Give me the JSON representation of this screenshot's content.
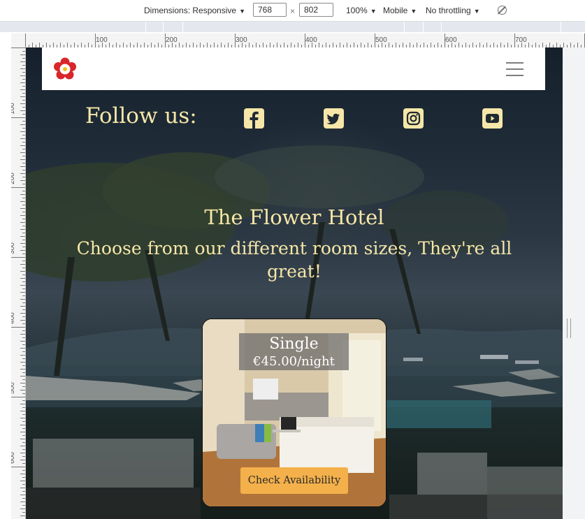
{
  "devtools": {
    "dimensions_label": "Dimensions: Responsive",
    "width_value": "768",
    "times_sign": "×",
    "height_value": "802",
    "zoom": "100%",
    "device_mode": "Mobile",
    "throttling": "No throttling",
    "ruler_top_labels": [
      "100",
      "200",
      "300",
      "400",
      "500",
      "600",
      "700"
    ],
    "ruler_left_labels": [
      "100",
      "200",
      "300",
      "400",
      "500",
      "600"
    ]
  },
  "navbar": {
    "logo_icon": "tudor-rose-icon",
    "menu_icon": "hamburger-menu-icon"
  },
  "social": {
    "label": "Follow us:",
    "icons": [
      "facebook-icon",
      "twitter-icon",
      "instagram-icon",
      "youtube-icon"
    ]
  },
  "hero": {
    "title": "The Flower Hotel",
    "subtitle": "Choose from our different room sizes, They're all great!"
  },
  "room": {
    "name": "Single",
    "price": "€45.00/night",
    "button_label": "Check Availability"
  },
  "colors": {
    "heading_text": "#f6e7a8",
    "button_bg": "#f4b04a",
    "navbar_bg": "#ffffff"
  }
}
